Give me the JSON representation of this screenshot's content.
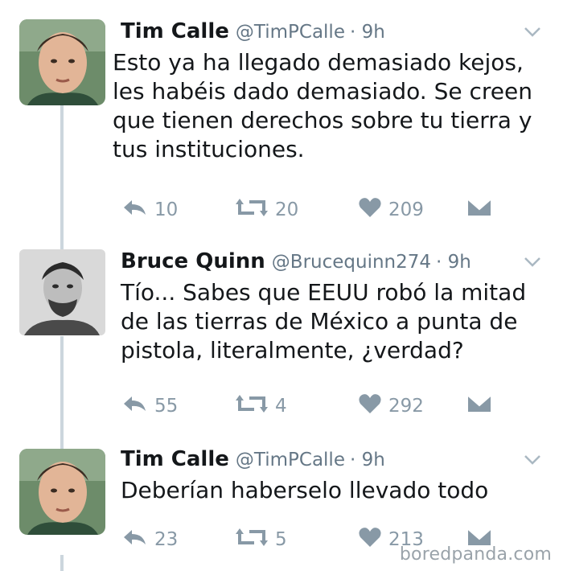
{
  "tweets": [
    {
      "name": "Tim Calle",
      "handle": "@TimPCalle",
      "time": "· 9h",
      "text": "Esto ya ha llegado demasiado kejos, les habéis dado demasiado. Se creen que tienen derechos sobre tu tierra y tus instituciones.",
      "replies": "10",
      "retweets": "20",
      "likes": "209"
    },
    {
      "name": "Bruce Quinn",
      "handle": "@Brucequinn274",
      "time": "· 9h",
      "text": "Tío... Sabes que EEUU robó la mitad de las tierras de México a punta de pistola, literalmente, ¿verdad?",
      "replies": "55",
      "retweets": "4",
      "likes": "292"
    },
    {
      "name": "Tim Calle",
      "handle": "@TimPCalle",
      "time": "· 9h",
      "text": "Deberían haberselo llevado todo",
      "replies": "23",
      "retweets": "5",
      "likes": "213"
    }
  ],
  "watermark": "boredpanda.com",
  "colors": {
    "text": "#14171a",
    "secondary": "#657786",
    "icon": "#8899a6",
    "thread_line": "#ccd6dd"
  },
  "icons": [
    "reply-icon",
    "retweet-icon",
    "heart-icon",
    "direct-message-icon",
    "chevron-down-icon"
  ]
}
